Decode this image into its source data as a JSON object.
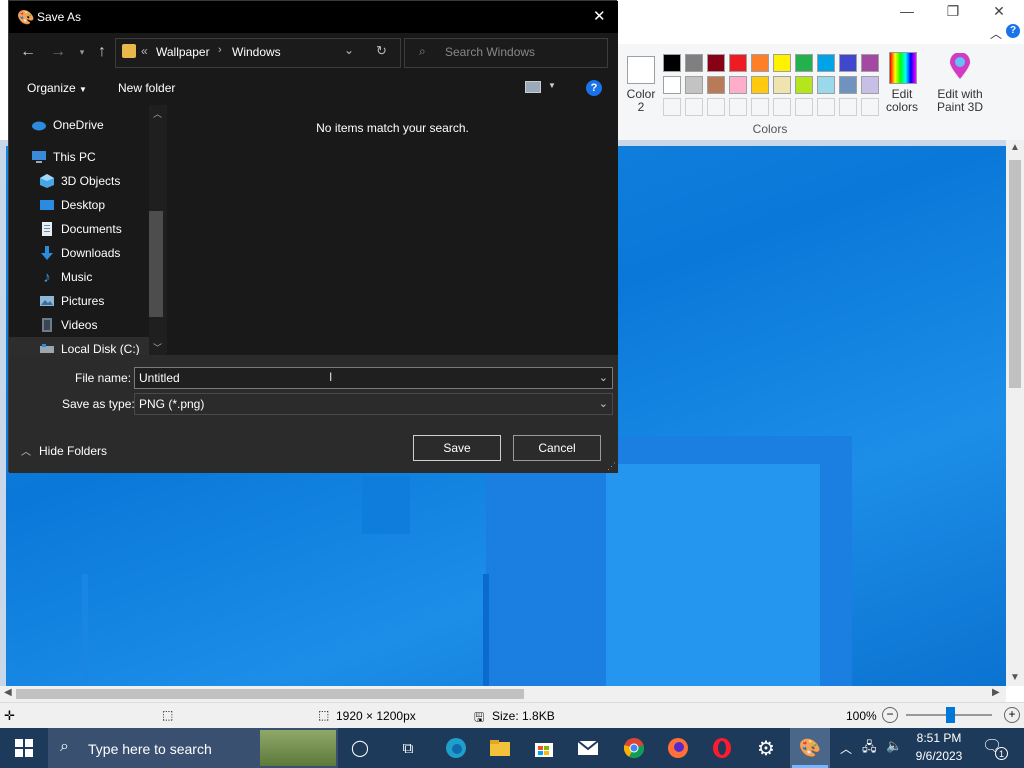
{
  "dialog": {
    "title": "Save As",
    "breadcrumb": {
      "overflow": "«",
      "items": [
        "Wallpaper",
        "Windows"
      ]
    },
    "search_placeholder": "Search Windows",
    "organize_label": "Organize",
    "new_folder_label": "New folder",
    "empty_message": "No items match your search.",
    "nav_items": [
      {
        "label": "OneDrive",
        "icon": "cloud-icon"
      },
      {
        "label": "This PC",
        "icon": "computer-icon"
      },
      {
        "label": "3D Objects",
        "icon": "cube-icon"
      },
      {
        "label": "Desktop",
        "icon": "desktop-icon"
      },
      {
        "label": "Documents",
        "icon": "document-icon"
      },
      {
        "label": "Downloads",
        "icon": "download-icon"
      },
      {
        "label": "Music",
        "icon": "music-icon"
      },
      {
        "label": "Pictures",
        "icon": "pictures-icon"
      },
      {
        "label": "Videos",
        "icon": "video-icon"
      },
      {
        "label": "Local Disk (C:)",
        "icon": "drive-icon"
      }
    ],
    "file_name_label": "File name:",
    "file_name_value": "Untitled",
    "save_type_label": "Save as type:",
    "save_type_value": "PNG (*.png)",
    "hide_folders_label": "Hide Folders",
    "save_label": "Save",
    "cancel_label": "Cancel"
  },
  "paint": {
    "color2_label": "Color\n2",
    "colors_group_label": "Colors",
    "edit_colors_label": "Edit\ncolors",
    "edit_paint3d_label": "Edit with\nPaint 3D",
    "palette_row1": [
      "#000000",
      "#7f7f7f",
      "#880015",
      "#ed1c24",
      "#ff7f27",
      "#fff200",
      "#22b14c",
      "#00a2e8",
      "#3f48cc",
      "#a349a4"
    ],
    "palette_row2": [
      "#ffffff",
      "#c3c3c3",
      "#b97a57",
      "#ffaec9",
      "#ffc90e",
      "#efe4b0",
      "#b5e61d",
      "#99d9ea",
      "#7092be",
      "#c8bfe7"
    ],
    "status": {
      "dimensions": "1920 × 1200px",
      "size": "Size: 1.8KB",
      "zoom": "100%"
    }
  },
  "taskbar": {
    "search_placeholder": "Type here to search",
    "time": "8:51 PM",
    "date": "9/6/2023",
    "notification_count": "1"
  }
}
